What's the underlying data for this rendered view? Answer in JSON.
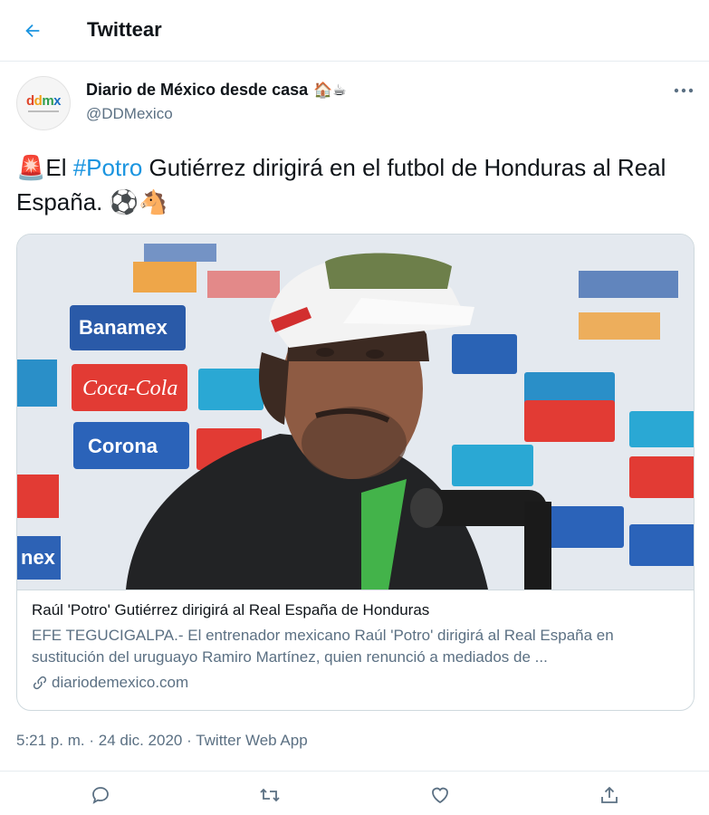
{
  "header": {
    "title": "Twittear"
  },
  "author": {
    "avatar_text": "ddmx",
    "display_name": "Diario de México desde casa",
    "name_emojis": "🏠☕",
    "handle": "@DDMexico"
  },
  "tweet": {
    "prefix_emoji": "🚨",
    "text_before": "El ",
    "hashtag": "#Potro",
    "text_after": " Gutiérrez dirigirá en el futbol de Honduras al Real España. ",
    "trailing_emojis": "⚽🐴"
  },
  "card": {
    "title": "Raúl 'Potro' Gutiérrez dirigirá al Real España de Honduras",
    "description": "EFE TEGUCIGALPA.- El entrenador mexicano Raúl 'Potro' dirigirá al Real España en sustitución del uruguayo Ramiro Martínez, quien renunció a mediados de ...",
    "domain": "diariodemexico.com",
    "image": {
      "sponsors": [
        "Banamex",
        "Coca-Cola",
        "Corona",
        "nex"
      ]
    }
  },
  "meta": {
    "time": "5:21 p. m.",
    "separator": "·",
    "date": "24 dic. 2020",
    "source": "Twitter Web App"
  },
  "colors": {
    "accent": "#1b95e0",
    "text": "#0f1419",
    "secondary": "#5b7083",
    "border": "#cfd9de"
  }
}
